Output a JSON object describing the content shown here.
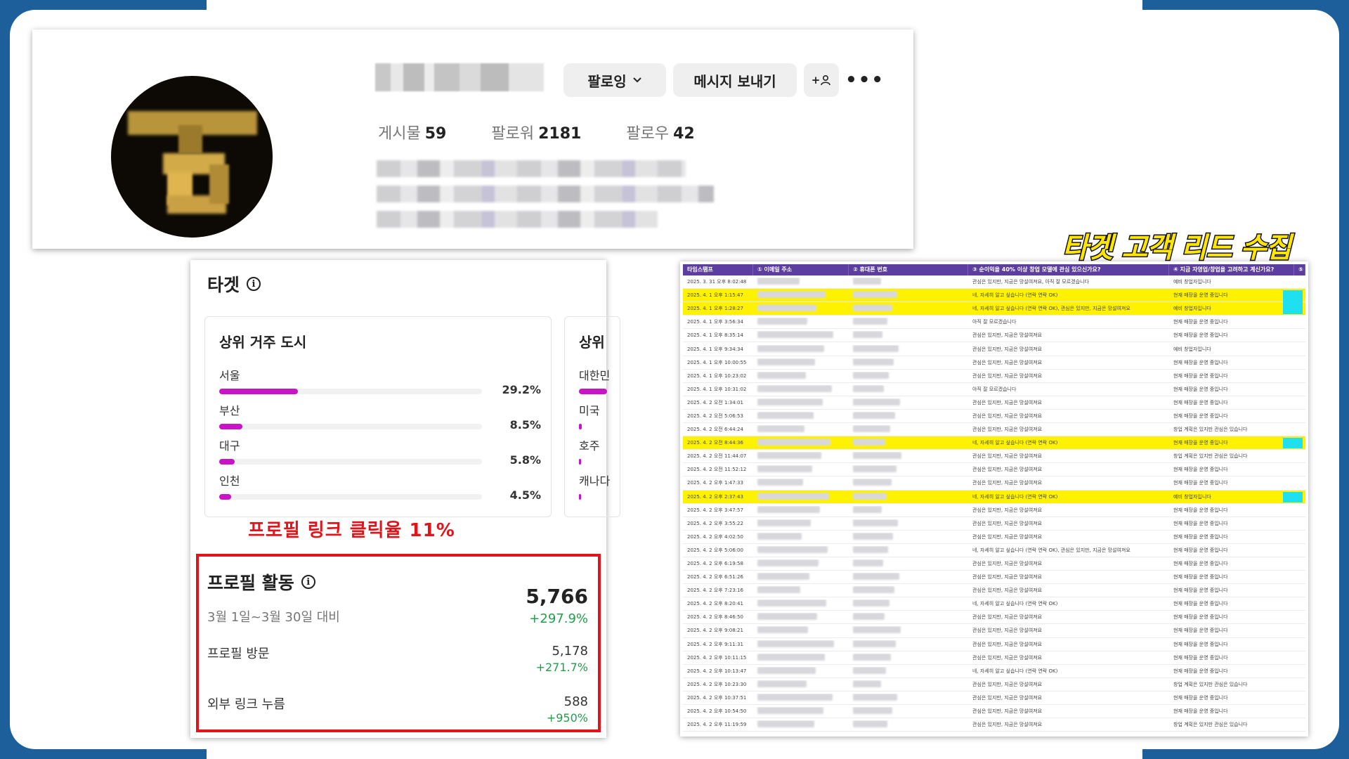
{
  "profile": {
    "follow_button": "팔로잉",
    "message_button": "메시지 보내기",
    "add_person_icon": "+",
    "stats": [
      {
        "label": "게시물",
        "value": "59"
      },
      {
        "label": "팔로워",
        "value": "2181"
      },
      {
        "label": "팔로우",
        "value": "42"
      }
    ]
  },
  "target": {
    "title": "타겟",
    "city_card_title": "상위 거주 도시",
    "cities": [
      {
        "name": "서울",
        "pct": "29.2%",
        "fraction": 0.292
      },
      {
        "name": "부산",
        "pct": "8.5%",
        "fraction": 0.085
      },
      {
        "name": "대구",
        "pct": "5.8%",
        "fraction": 0.058
      },
      {
        "name": "인천",
        "pct": "4.5%",
        "fraction": 0.045
      }
    ],
    "country_card_title": "상위",
    "countries": [
      "대한민",
      "미국",
      "호주",
      "캐나다"
    ],
    "click_rate_annotation": "프로필 링크 클릭율 11%"
  },
  "activity": {
    "title": "프로필 활동",
    "period": "3월 1일~3월 30일 대비",
    "total": "5,766",
    "total_change": "+297.9%",
    "rows": [
      {
        "label": "프로필 방문",
        "value": "5,178",
        "change": "+271.7%"
      },
      {
        "label": "외부 링크 누름",
        "value": "588",
        "change": "+950%"
      }
    ]
  },
  "lead": {
    "title": "타겟 고객 리드 수집",
    "headers": [
      "타임스탬프",
      "① 이메일 주소",
      "② 휴대폰 번호",
      "③ 순이익을 40% 이상 창업 모델에 관심 있으신가요?",
      "④ 지금 자영업/창업을 고려하고 계신가요?",
      "⑤"
    ],
    "rows": [
      {
        "ts": "2025. 3. 31 오후 8:02:48",
        "q3": "관심은 있지만, 지금은 망설여져요, 아직 잘 모르겠습니다",
        "q4": "예비 창업자입니다",
        "hl": false
      },
      {
        "ts": "2025. 4. 1 오후 1:15:47",
        "q3": "네, 자세히 알고 싶습니다 (연락 연락 OK)",
        "q4": "현재 매장을 운영 중입니다",
        "hl": true
      },
      {
        "ts": "2025. 4. 1 오후 1:28:27",
        "q3": "네, 자세히 알고 싶습니다 (연락 연락 OK), 관심은 있지만, 지금은 망설여져요",
        "q4": "예비 창업자입니다",
        "hl": true
      },
      {
        "ts": "2025. 4. 1 오후 3:56:34",
        "q3": "아직 잘 모르겠습니다",
        "q4": "현재 매장을 운영 중입니다",
        "hl": false
      },
      {
        "ts": "2025. 4. 1 오후 8:35:14",
        "q3": "관심은 있지만, 지금은 망설여져요",
        "q4": "현재 매장을 운영 중입니다",
        "hl": false
      },
      {
        "ts": "2025. 4. 1 오후 9:34:34",
        "q3": "관심은 있지만, 지금은 망설여져요",
        "q4": "예비 창업자입니다",
        "hl": false
      },
      {
        "ts": "2025. 4. 1 오후 10:00:55",
        "q3": "관심은 있지만, 지금은 망설여져요",
        "q4": "현재 매장을 운영 중입니다",
        "hl": false
      },
      {
        "ts": "2025. 4. 1 오후 10:23:02",
        "q3": "관심은 있지만, 지금은 망설여져요",
        "q4": "현재 매장을 운영 중입니다",
        "hl": false
      },
      {
        "ts": "2025. 4. 1 오후 10:31:02",
        "q3": "아직 잘 모르겠습니다",
        "q4": "현재 매장을 운영 중입니다",
        "hl": false
      },
      {
        "ts": "2025. 4. 2 오전 1:34:01",
        "q3": "관심은 있지만, 지금은 망설여져요",
        "q4": "현재 매장을 운영 중입니다",
        "hl": false
      },
      {
        "ts": "2025. 4. 2 오전 5:06:53",
        "q3": "관심은 있지만, 지금은 망설여져요",
        "q4": "현재 매장을 운영 중입니다",
        "hl": false
      },
      {
        "ts": "2025. 4. 2 오전 6:44:24",
        "q3": "관심은 있지만, 지금은 망설여져요",
        "q4": "창업 계획은 있지만 관심은 있습니다",
        "hl": false
      },
      {
        "ts": "2025. 4. 2 오전 8:44:36",
        "q3": "네, 자세히 알고 싶습니다 (연락 연락 OK)",
        "q4": "현재 매장을 운영 중입니다",
        "hl": true
      },
      {
        "ts": "2025. 4. 2 오전 11:44:07",
        "q3": "관심은 있지만, 지금은 망설여져요",
        "q4": "창업 계획은 있지만 관심은 있습니다",
        "hl": false
      },
      {
        "ts": "2025. 4. 2 오전 11:52:12",
        "q3": "관심은 있지만, 지금은 망설여져요",
        "q4": "현재 매장을 운영 중입니다",
        "hl": false
      },
      {
        "ts": "2025. 4. 2 오후 1:47:33",
        "q3": "관심은 있지만, 지금은 망설여져요",
        "q4": "현재 매장을 운영 중입니다",
        "hl": false
      },
      {
        "ts": "2025. 4. 2 오후 2:37:43",
        "q3": "네, 자세히 알고 싶습니다 (연락 연락 OK)",
        "q4": "예비 창업자입니다",
        "hl": true
      },
      {
        "ts": "2025. 4. 2 오후 3:47:57",
        "q3": "관심은 있지만, 지금은 망설여져요",
        "q4": "현재 매장을 운영 중입니다",
        "hl": false
      },
      {
        "ts": "2025. 4. 2 오후 3:55:22",
        "q3": "관심은 있지만, 지금은 망설여져요",
        "q4": "현재 매장을 운영 중입니다",
        "hl": false
      },
      {
        "ts": "2025. 4. 2 오후 4:02:50",
        "q3": "관심은 있지만, 지금은 망설여져요",
        "q4": "현재 매장을 운영 중입니다",
        "hl": false
      },
      {
        "ts": "2025. 4. 2 오후 5:06:00",
        "q3": "네, 자세히 알고 싶습니다 (연락 연락 OK), 관심은 있지만, 지금은 망설여져요",
        "q4": "현재 매장을 운영 중입니다",
        "hl": false
      },
      {
        "ts": "2025. 4. 2 오후 6:19:58",
        "q3": "관심은 있지만, 지금은 망설여져요",
        "q4": "현재 매장을 운영 중입니다",
        "hl": false
      },
      {
        "ts": "2025. 4. 2 오후 6:51:26",
        "q3": "관심은 있지만, 지금은 망설여져요",
        "q4": "현재 매장을 운영 중입니다",
        "hl": false
      },
      {
        "ts": "2025. 4. 2 오후 7:23:16",
        "q3": "관심은 있지만, 지금은 망설여져요",
        "q4": "현재 매장을 운영 중입니다",
        "hl": false
      },
      {
        "ts": "2025. 4. 2 오후 8:20:41",
        "q3": "네, 자세히 알고 싶습니다 (연락 연락 OK)",
        "q4": "현재 매장을 운영 중입니다",
        "hl": false
      },
      {
        "ts": "2025. 4. 2 오후 8:46:50",
        "q3": "관심은 있지만, 지금은 망설여져요",
        "q4": "현재 매장을 운영 중입니다",
        "hl": false
      },
      {
        "ts": "2025. 4. 2 오후 9:08:21",
        "q3": "관심은 있지만, 지금은 망설여져요",
        "q4": "현재 매장을 운영 중입니다",
        "hl": false
      },
      {
        "ts": "2025. 4. 2 오후 9:11:31",
        "q3": "관심은 있지만, 지금은 망설여져요",
        "q4": "현재 매장을 운영 중입니다",
        "hl": false
      },
      {
        "ts": "2025. 4. 2 오후 10:11:15",
        "q3": "관심은 있지만, 지금은 망설여져요",
        "q4": "현재 매장을 운영 중입니다",
        "hl": false
      },
      {
        "ts": "2025. 4. 2 오후 10:13:47",
        "q3": "네, 자세히 알고 싶습니다 (연락 연락 OK)",
        "q4": "현재 매장을 운영 중입니다",
        "hl": false
      },
      {
        "ts": "2025. 4. 2 오후 10:23:30",
        "q3": "관심은 있지만, 지금은 망설여져요",
        "q4": "창업 계획은 있지만 관심은 있습니다",
        "hl": false
      },
      {
        "ts": "2025. 4. 2 오후 10:37:51",
        "q3": "관심은 있지만, 지금은 망설여져요",
        "q4": "현재 매장을 운영 중입니다",
        "hl": false
      },
      {
        "ts": "2025. 4. 2 오후 10:54:50",
        "q3": "관심은 있지만, 지금은 망설여져요",
        "q4": "현재 매장을 운영 중입니다",
        "hl": false
      },
      {
        "ts": "2025. 4. 2 오후 11:19:59",
        "q3": "관심은 있지만, 지금은 망설여져요",
        "q4": "창업 계획은 있지만 관심은 있습니다",
        "hl": false
      }
    ]
  },
  "colors": {
    "accent_magenta": "#c913c6",
    "highlight_yellow": "#fff200",
    "positive_green": "#20a04b",
    "annotation_red": "#e0151b",
    "sheet_header_purple": "#5b3ea0"
  }
}
